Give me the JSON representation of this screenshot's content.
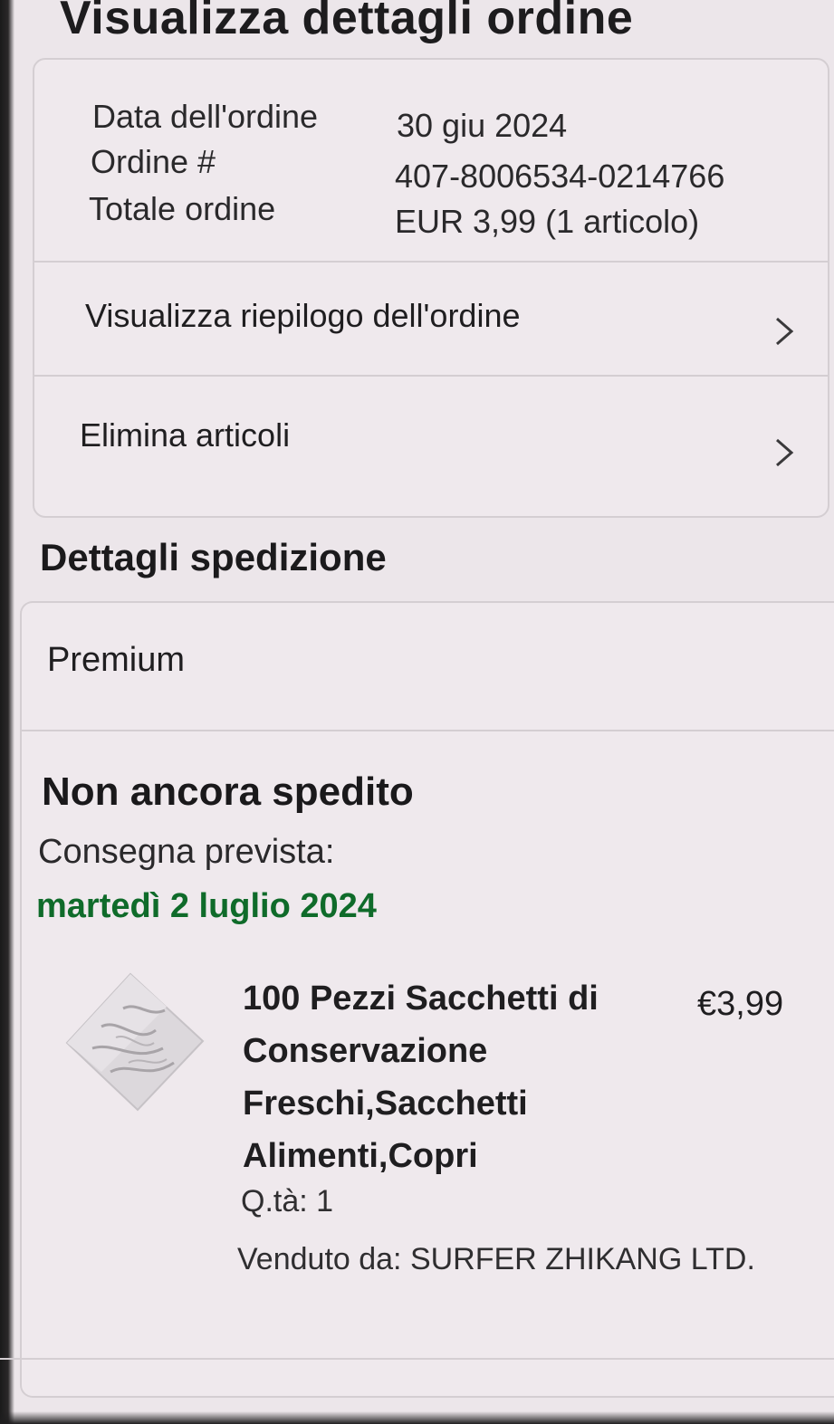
{
  "page": {
    "title": "Visualizza dettagli ordine"
  },
  "order_summary": {
    "date_label": "Data dell'ordine",
    "date_value": "30 giu 2024",
    "number_label": "Ordine #",
    "number_value": "407-8006534-0214766",
    "total_label": "Totale ordine",
    "total_value": "EUR 3,99 (1 articolo)"
  },
  "order_actions": [
    {
      "label": "Visualizza riepilogo dell'ordine",
      "icon": "chevron-right-icon"
    },
    {
      "label": "Elimina articoli",
      "icon": "chevron-right-icon"
    }
  ],
  "shipping": {
    "section_title": "Dettagli spedizione",
    "service": "Premium",
    "status": "Non ancora spedito",
    "delivery_label": "Consegna prevista:",
    "delivery_date": "martedì 2 luglio 2024",
    "delivery_date_color": "#0f6b2a",
    "item": {
      "title": "100 Pezzi Sacchetti di Conservazione Freschi,Sacchetti Alimenti,Copri",
      "price": "€3,99",
      "quantity": "Q.tà: 1",
      "seller": "Venduto da: SURFER ZHIKANG LTD.",
      "image_icon": "product-bag-image"
    }
  }
}
